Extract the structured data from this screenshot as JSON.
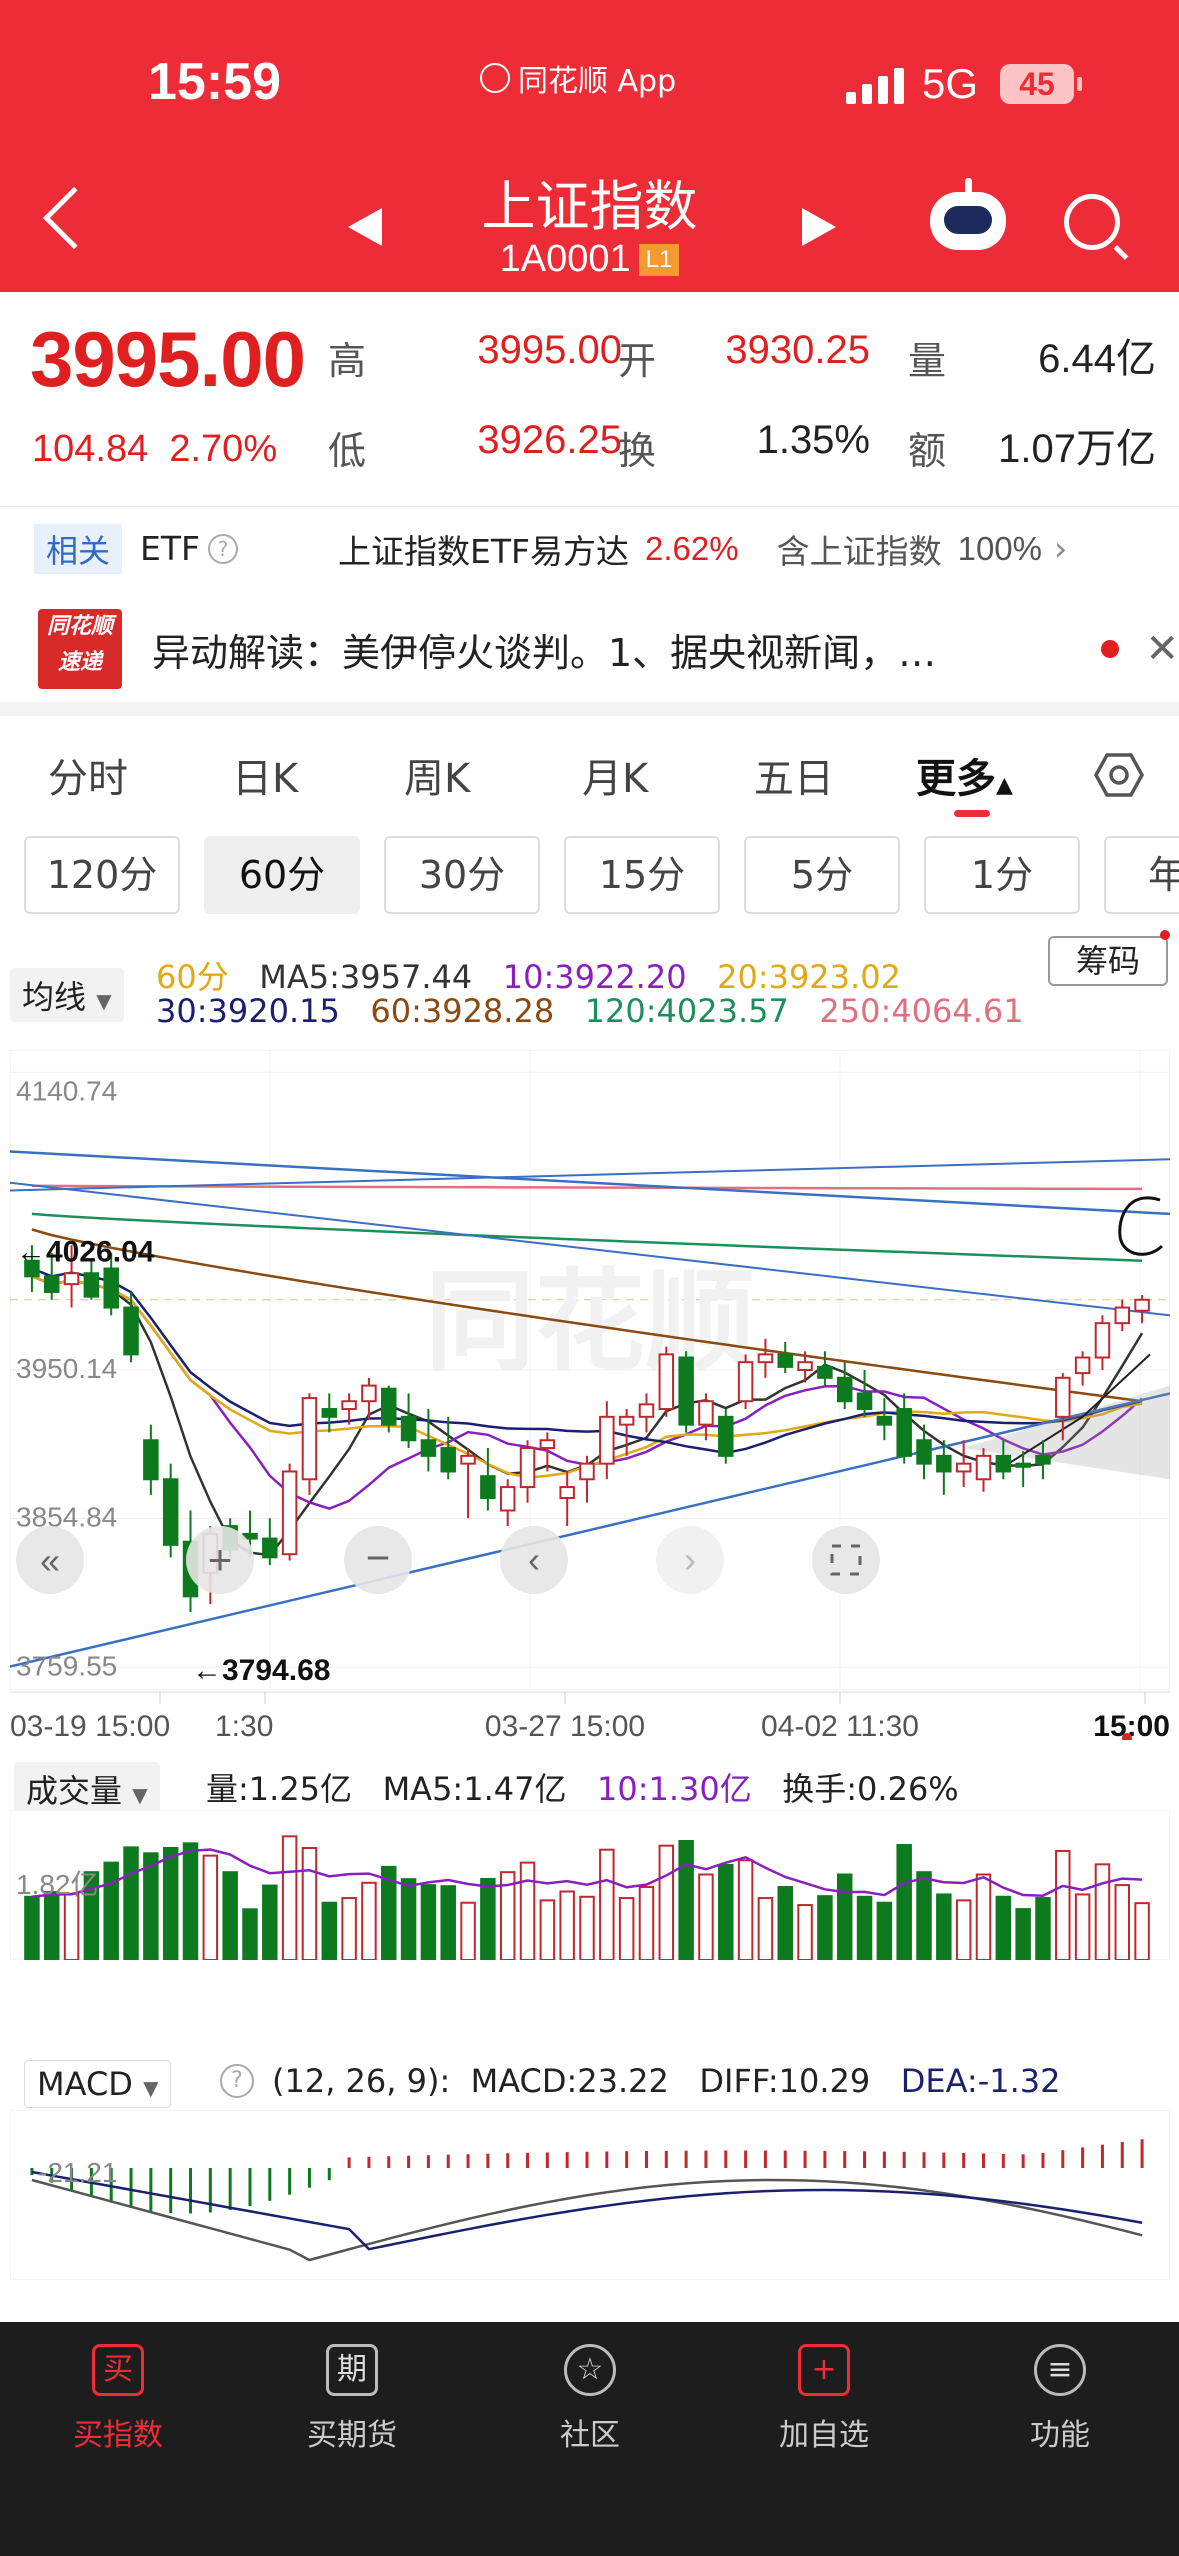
{
  "status": {
    "time": "15:59",
    "app": "同花顺 App",
    "network": "5G",
    "battery": "45"
  },
  "header": {
    "title": "上证指数",
    "code": "1A0001",
    "badge": "L1"
  },
  "quote": {
    "price": "3995.00",
    "change": "104.84",
    "pct": "2.70%",
    "high_l": "高",
    "high": "3995.00",
    "open_l": "开",
    "open": "3930.25",
    "vol_l": "量",
    "vol": "6.44亿",
    "low_l": "低",
    "low": "3926.25",
    "turn_l": "换",
    "turn": "1.35%",
    "amt_l": "额",
    "amt": "1.07万亿"
  },
  "etf": {
    "tag": "相关",
    "label": "ETF",
    "name": "上证指数ETF易方达",
    "pct": "2.62%",
    "holds": "含上证指数",
    "holds_pct": "100%"
  },
  "news": {
    "logo1": "同花顺",
    "logo2": "速递",
    "text": "异动解读：美伊停火谈判。1、据央视新闻，…"
  },
  "tabs": [
    "分时",
    "日K",
    "周K",
    "月K",
    "五日",
    "更多"
  ],
  "periods": [
    "120分",
    "60分",
    "30分",
    "15分",
    "5分",
    "1分",
    "年"
  ],
  "ma": {
    "selector": "均线",
    "period": "60分",
    "ma5": "MA5:3957.44",
    "ma10": "10:3922.20",
    "ma20": "20:3923.02",
    "ma30": "30:3920.15",
    "ma60": "60:3928.28",
    "ma120": "120:4023.57",
    "ma250": "250:4064.61",
    "chip": "筹码"
  },
  "colors": {
    "accent": "#ee2c38",
    "up": "#c0282d",
    "down": "#0e7a1f",
    "ma5": "#333333",
    "ma10": "#8a1fbf",
    "ma20": "#e3a815",
    "ma30": "#1a1f70",
    "ma60": "#8a4a10",
    "ma120": "#1c8f5a",
    "ma250": "#e07080"
  },
  "chart_data": {
    "type": "candlestick",
    "y_ticks": [
      "4140.74",
      "3950.14",
      "3854.84",
      "3759.55"
    ],
    "x_ticks": [
      "03-19 15:00",
      "1:30",
      "03-27 15:00",
      "04-02 11:30",
      "15:00"
    ],
    "annotations": [
      "←4026.04",
      "←3794.68"
    ],
    "ylim": [
      3759.55,
      4140.74
    ],
    "candles": [
      [
        4020,
        4030,
        4000,
        4010
      ],
      [
        4010,
        4025,
        3995,
        4000
      ],
      [
        4005,
        4030,
        3990,
        4012
      ],
      [
        4012,
        4020,
        3995,
        3997
      ],
      [
        4015,
        4025,
        3985,
        3990
      ],
      [
        3990,
        4000,
        3955,
        3960
      ],
      [
        3905,
        3915,
        3870,
        3880
      ],
      [
        3880,
        3890,
        3830,
        3838
      ],
      [
        3840,
        3860,
        3795,
        3805
      ],
      [
        3820,
        3850,
        3800,
        3845
      ],
      [
        3850,
        3855,
        3830,
        3835
      ],
      [
        3845,
        3860,
        3830,
        3842
      ],
      [
        3842,
        3855,
        3825,
        3830
      ],
      [
        3832,
        3890,
        3828,
        3885
      ],
      [
        3880,
        3935,
        3870,
        3932
      ],
      [
        3925,
        3935,
        3910,
        3920
      ],
      [
        3925,
        3935,
        3915,
        3930
      ],
      [
        3930,
        3945,
        3918,
        3940
      ],
      [
        3938,
        3940,
        3910,
        3915
      ],
      [
        3920,
        3935,
        3900,
        3905
      ],
      [
        3905,
        3925,
        3885,
        3895
      ],
      [
        3900,
        3920,
        3880,
        3885
      ],
      [
        3890,
        3900,
        3855,
        3895
      ],
      [
        3882,
        3900,
        3860,
        3868
      ],
      [
        3860,
        3880,
        3850,
        3875
      ],
      [
        3875,
        3905,
        3865,
        3900
      ],
      [
        3900,
        3910,
        3885,
        3905
      ],
      [
        3868,
        3885,
        3850,
        3875
      ],
      [
        3880,
        3895,
        3865,
        3890
      ],
      [
        3890,
        3930,
        3880,
        3920
      ],
      [
        3915,
        3925,
        3895,
        3920
      ],
      [
        3920,
        3935,
        3910,
        3928
      ],
      [
        3925,
        3965,
        3920,
        3960
      ],
      [
        3958,
        3962,
        3910,
        3915
      ],
      [
        3915,
        3935,
        3905,
        3930
      ],
      [
        3920,
        3925,
        3890,
        3895
      ],
      [
        3930,
        3960,
        3925,
        3955
      ],
      [
        3955,
        3970,
        3945,
        3960
      ],
      [
        3960,
        3968,
        3948,
        3952
      ],
      [
        3950,
        3962,
        3942,
        3955
      ],
      [
        3952,
        3962,
        3940,
        3945
      ],
      [
        3945,
        3955,
        3925,
        3930
      ],
      [
        3935,
        3950,
        3920,
        3925
      ],
      [
        3920,
        3932,
        3905,
        3915
      ],
      [
        3925,
        3935,
        3890,
        3895
      ],
      [
        3905,
        3915,
        3880,
        3890
      ],
      [
        3895,
        3905,
        3870,
        3885
      ],
      [
        3885,
        3905,
        3875,
        3890
      ],
      [
        3880,
        3900,
        3872,
        3895
      ],
      [
        3895,
        3905,
        3880,
        3885
      ],
      [
        3890,
        3898,
        3875,
        3888
      ],
      [
        3895,
        3905,
        3880,
        3890
      ],
      [
        3920,
        3948,
        3905,
        3945
      ],
      [
        3948,
        3962,
        3940,
        3958
      ],
      [
        3958,
        3985,
        3950,
        3980
      ],
      [
        3980,
        3995,
        3975,
        3990
      ],
      [
        3988,
        3998,
        3980,
        3995
      ]
    ],
    "volume": {
      "selector": "成交量",
      "vol": "量:1.25亿",
      "ma5": "MA5:1.47亿",
      "ma10": "10:1.30亿",
      "turnover": "换手:0.26%",
      "tick": "1.82亿"
    },
    "macd": {
      "selector": "MACD",
      "params": "(12, 26, 9):",
      "macd": "MACD:23.22",
      "diff": "DIFF:10.29",
      "dea": "DEA:-1.32",
      "tick": "-21.21"
    }
  },
  "bottom": [
    "买指数",
    "买期货",
    "社区",
    "加自选",
    "功能"
  ]
}
